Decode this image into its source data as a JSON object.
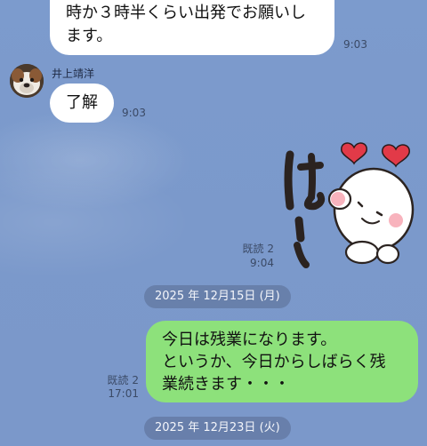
{
  "messages": {
    "m1": {
      "text": "時か３時半くらい出発でお願いします。",
      "time": "9:03"
    },
    "m2": {
      "sender": "井上靖洋",
      "text": "了解",
      "time": "9:03"
    },
    "m3": {
      "sticker": "はーい",
      "read": "既読 2",
      "time": "9:04"
    },
    "m4": {
      "read": "既読 2",
      "time": "17:01",
      "lines": [
        "今日は残業になります。",
        "というか、今日からしばらく残",
        "業続きます・・・"
      ]
    }
  },
  "dates": {
    "d1": "2025 年 12月15日 (月)",
    "d2": "2025 年 12月23日 (火)"
  },
  "colors": {
    "background": "#7b9acb",
    "outgoing_bubble": "#8de17b",
    "incoming_bubble": "#ffffff"
  },
  "icons": {
    "sticker": "smiling-face-with-hearts-sticker",
    "avatar": "dog-avatar"
  }
}
